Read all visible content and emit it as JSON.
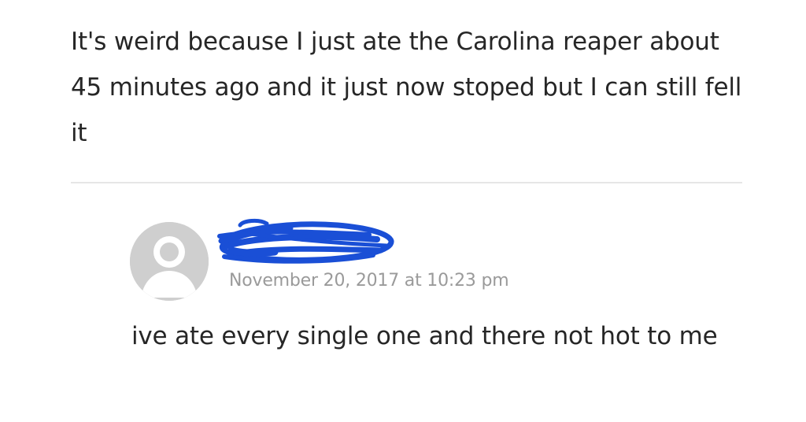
{
  "comment": {
    "body": "It's weird because I just ate the Carolina reaper about 45 minutes ago and it just now stoped but I can still fell it"
  },
  "reply": {
    "avatar_icon": "default-avatar-icon",
    "author_redaction_icon": "blue-scribble-redaction",
    "timestamp": "November 20, 2017 at 10:23 pm",
    "body": "ive ate every single one and there not hot to me"
  },
  "colors": {
    "text": "#262626",
    "timestamp": "#9a9a9a",
    "avatar": "#cfcfcf",
    "redaction": "#1a4fd6",
    "divider": "#e6e6e6"
  }
}
